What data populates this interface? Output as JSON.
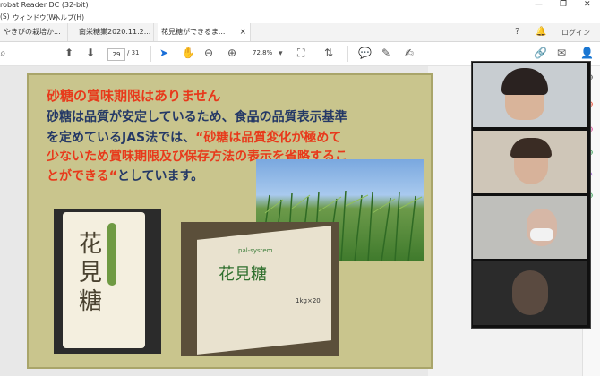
{
  "window": {
    "title": "robat Reader DC (32-bit)",
    "minimize": "—",
    "restore": "❐",
    "close": "✕"
  },
  "menu": {
    "item1": "(S)",
    "item2": "ウィンドウ(W)",
    "item3": "ヘルプ(H)"
  },
  "tabs": [
    {
      "label": "やきびの栽培か..."
    },
    {
      "label": "南栄糖業2020.11.2..."
    },
    {
      "label": "花見糖ができるま...",
      "close": "×"
    }
  ],
  "topright": {
    "help": "?",
    "bell": "🔔",
    "login": "ログイン"
  },
  "toolbar": {
    "search": "⌕",
    "up": "⬆",
    "down": "⬇",
    "page_current": "29",
    "page_total": "/ 31",
    "select": "➤",
    "hand": "✋",
    "zoom_out": "⊖",
    "zoom_in": "⊕",
    "zoom_level": "72.8%",
    "dropdown": "▾",
    "fit": "⛶",
    "scroll": "⇅",
    "comment": "💬",
    "pen": "✎",
    "sign": "✍",
    "share": "🔗",
    "mail": "✉",
    "user": "👤"
  },
  "slide": {
    "title": "砂糖の賞味期限はありません",
    "line1": "砂糖は品質が安定しているため、食品の品質表示基準",
    "line2_a": "を定めているJAS法では、",
    "line2_b": "“砂糖は品質変化が極めて",
    "line3": "少ないため賞味期限及び保存方法の表示を省略するこ",
    "line4_a": "とができる“",
    "line4_b": "としています。",
    "pack1_text": "花見糖",
    "pack2_brand": "pal-system",
    "pack2_text": "花見糖",
    "pack2_weight": "1kg×20"
  },
  "side_icons": [
    "⊕",
    "⊕",
    "⊕",
    "⊕",
    "✎",
    "⊕"
  ]
}
